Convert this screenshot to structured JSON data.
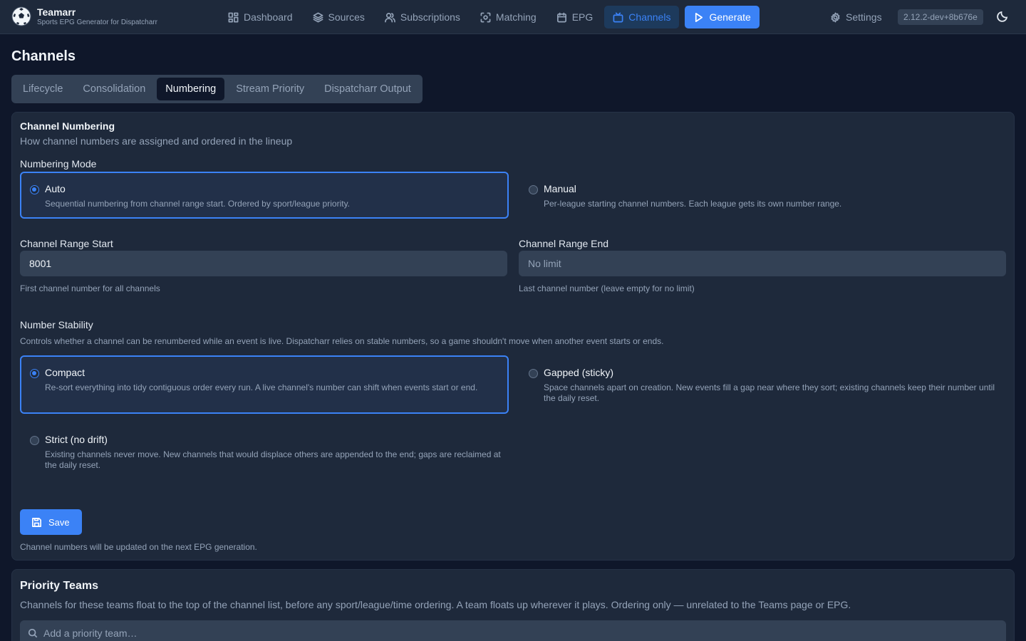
{
  "brand": {
    "title": "Teamarr",
    "subtitle": "Sports EPG Generator for Dispatcharr"
  },
  "nav": {
    "items": [
      {
        "label": "Dashboard",
        "icon": "dashboard-icon"
      },
      {
        "label": "Sources",
        "icon": "layers-icon"
      },
      {
        "label": "Subscriptions",
        "icon": "users-icon"
      },
      {
        "label": "Matching",
        "icon": "scan-icon"
      },
      {
        "label": "EPG",
        "icon": "calendar-icon"
      },
      {
        "label": "Channels",
        "icon": "tv-icon",
        "active": true
      }
    ],
    "generate_label": "Generate",
    "settings_label": "Settings",
    "version": "2.12.2-dev+8b676e"
  },
  "page": {
    "title": "Channels"
  },
  "tabs": [
    {
      "label": "Lifecycle"
    },
    {
      "label": "Consolidation"
    },
    {
      "label": "Numbering",
      "active": true
    },
    {
      "label": "Stream Priority"
    },
    {
      "label": "Dispatcharr Output"
    }
  ],
  "numbering": {
    "title": "Channel Numbering",
    "description": "How channel numbers are assigned and ordered in the lineup",
    "mode_label": "Numbering Mode",
    "modes": [
      {
        "title": "Auto",
        "desc": "Sequential numbering from channel range start. Ordered by sport/league priority.",
        "selected": true
      },
      {
        "title": "Manual",
        "desc": "Per-league starting channel numbers. Each league gets its own number range.",
        "selected": false
      }
    ],
    "range_start": {
      "label": "Channel Range Start",
      "value": "8001",
      "help": "First channel number for all channels"
    },
    "range_end": {
      "label": "Channel Range End",
      "placeholder": "No limit",
      "value": "",
      "help": "Last channel number (leave empty for no limit)"
    },
    "stability_label": "Number Stability",
    "stability_desc": "Controls whether a channel can be renumbered while an event is live. Dispatcharr relies on stable numbers, so a game shouldn't move when another event starts or ends.",
    "stability_options": [
      {
        "title": "Compact",
        "desc": "Re-sort everything into tidy contiguous order every run. A live channel's number can shift when events start or end.",
        "selected": true
      },
      {
        "title": "Gapped (sticky)",
        "desc": "Space channels apart on creation. New events fill a gap near where they sort; existing channels keep their number until the daily reset.",
        "selected": false
      },
      {
        "title": "Strict (no drift)",
        "desc": "Existing channels never move. New channels that would displace others are appended to the end; gaps are reclaimed at the daily reset.",
        "selected": false
      }
    ],
    "save_label": "Save",
    "save_note": "Channel numbers will be updated on the next EPG generation."
  },
  "priority_teams": {
    "title": "Priority Teams",
    "description": "Channels for these teams float to the top of the channel list, before any sport/league/time ordering. A team floats up wherever it plays. Ordering only — unrelated to the Teams page or EPG.",
    "search_placeholder": "Add a priority team…"
  },
  "colors": {
    "background": "#0f172a",
    "card": "#1e293b",
    "accent": "#3b82f6",
    "muted_text": "#94a3b8"
  }
}
